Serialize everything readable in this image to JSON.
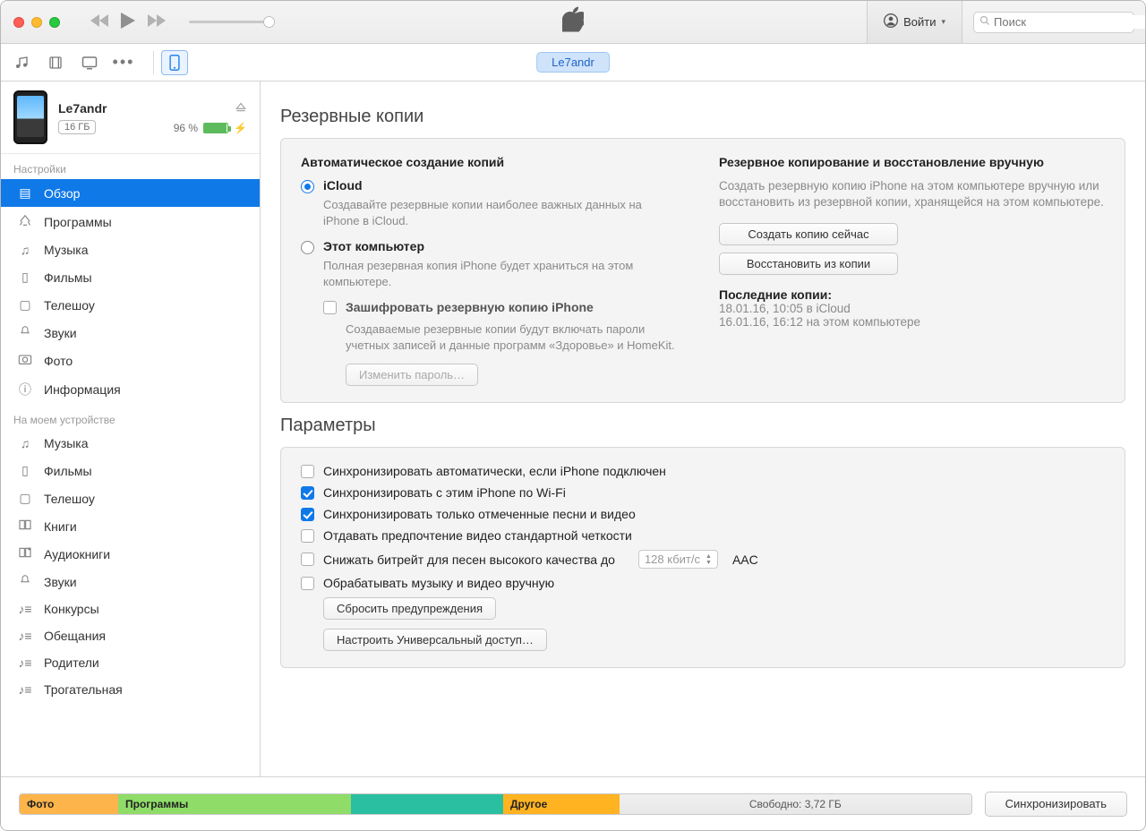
{
  "titlebar": {
    "signin_label": "Войти",
    "search_placeholder": "Поиск"
  },
  "device_pill": "Le7andr",
  "device": {
    "name": "Le7andr",
    "capacity_badge": "16 ГБ",
    "battery_pct": "96 %"
  },
  "sidebar": {
    "section_settings": "Настройки",
    "settings": [
      {
        "label": "Обзор"
      },
      {
        "label": "Программы"
      },
      {
        "label": "Музыка"
      },
      {
        "label": "Фильмы"
      },
      {
        "label": "Телешоу"
      },
      {
        "label": "Звуки"
      },
      {
        "label": "Фото"
      },
      {
        "label": "Информация"
      }
    ],
    "section_ondevice": "На моем устройстве",
    "ondevice": [
      {
        "label": "Музыка"
      },
      {
        "label": "Фильмы"
      },
      {
        "label": "Телешоу"
      },
      {
        "label": "Книги"
      },
      {
        "label": "Аудиокниги"
      },
      {
        "label": "Звуки"
      },
      {
        "label": "Конкурсы"
      },
      {
        "label": "Обещания"
      },
      {
        "label": "Родители"
      },
      {
        "label": "Трогательная"
      }
    ]
  },
  "backups": {
    "section_title": "Резервные копии",
    "auto_heading": "Автоматическое создание копий",
    "icloud_label": "iCloud",
    "icloud_desc": "Создавайте резервные копии наиболее важных данных на iPhone в iCloud.",
    "thispc_label": "Этот компьютер",
    "thispc_desc": "Полная резервная копия iPhone будет храниться на этом компьютере.",
    "encrypt_label": "Зашифровать резервную копию iPhone",
    "encrypt_desc": "Создаваемые резервные копии будут включать пароли учетных записей и данные программ «Здоровье» и HomeKit.",
    "change_pw_btn": "Изменить пароль…",
    "manual_heading": "Резервное копирование и восстановление вручную",
    "manual_desc": "Создать резервную копию iPhone на этом компьютере вручную или восстановить из резервной копии, хранящейся на этом компьютере.",
    "backup_now_btn": "Создать копию сейчас",
    "restore_btn": "Восстановить из копии",
    "last_title": "Последние копии:",
    "last_1": "18.01.16, 10:05 в iCloud",
    "last_2": "16.01.16, 16:12 на этом компьютере"
  },
  "options": {
    "section_title": "Параметры",
    "opt_autosync": "Синхронизировать автоматически, если iPhone подключен",
    "opt_wifi": "Синхронизировать с этим iPhone по Wi-Fi",
    "opt_checked_only": "Синхронизировать только отмеченные песни и видео",
    "opt_sdvideo": "Отдавать предпочтение видео стандартной четкости",
    "opt_bitrate": "Снижать битрейт для песен высокого качества до",
    "bitrate_select": "128 кбит/с",
    "bitrate_suffix": "AAC",
    "opt_manual": "Обрабатывать музыку и видео вручную",
    "reset_warnings_btn": "Сбросить предупреждения",
    "univ_access_btn": "Настроить Универсальный доступ…"
  },
  "bottom": {
    "photo": "Фото",
    "apps": "Программы",
    "other": "Другое",
    "free": "Свободно: 3,72 ГБ",
    "sync_btn": "Синхронизировать"
  }
}
